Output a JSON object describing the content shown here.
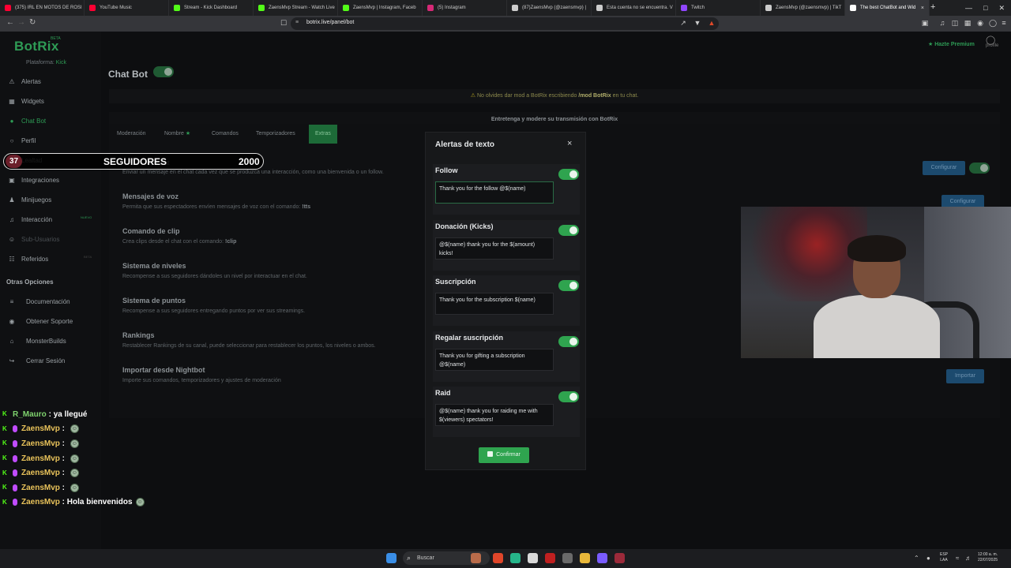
{
  "browser": {
    "tabs": [
      {
        "label": "(375) IRL EN MOTOS DE ROSI",
        "color": "#ff0033"
      },
      {
        "label": "YouTube Music",
        "color": "#ff0033"
      },
      {
        "label": "Stream - Kick Dashboard",
        "color": "#53fc18"
      },
      {
        "label": "ZaensMvp Stream - Watch Live",
        "color": "#53fc18"
      },
      {
        "label": "ZaensMvp | Instagram, Faceb",
        "color": "#53fc18"
      },
      {
        "label": "(5) Instagram",
        "color": "#d62976"
      },
      {
        "label": "(87)ZaensMvp (@zaensmvp) |",
        "color": "#cccccc"
      },
      {
        "label": "Esta cuenta no se encuentra. V",
        "color": "#cccccc"
      },
      {
        "label": "Twitch",
        "color": "#9146ff"
      },
      {
        "label": "ZaensMvp (@zaensmvp) | TikT",
        "color": "#cccccc"
      },
      {
        "label": "The best ChatBot and Wid",
        "color": "#ffffff",
        "active": true
      }
    ],
    "url": "botrix.live/panel/bot"
  },
  "sidebar": {
    "logo": "BotRix",
    "beta": "BETA",
    "platform_label": "Plataforma:",
    "platform_value": "Kick",
    "items": [
      {
        "label": "Alertas",
        "icon": "alert-icon"
      },
      {
        "label": "Widgets",
        "icon": "widgets-icon"
      },
      {
        "label": "Chat Bot",
        "icon": "chatbot-icon"
      },
      {
        "label": "Perfil",
        "icon": "profile-icon"
      },
      {
        "label": "Lealtad",
        "icon": "loyalty-icon"
      },
      {
        "label": "Integraciones",
        "icon": "integrations-icon"
      },
      {
        "label": "Minijuegos",
        "icon": "minigames-icon"
      },
      {
        "label": "Interacción",
        "icon": "interaction-icon"
      },
      {
        "label": "Sub-Usuarios",
        "icon": "subusers-icon"
      },
      {
        "label": "Referidos",
        "icon": "referrals-icon"
      }
    ],
    "badge_nuevo": "NUEVO",
    "badge_beta": "BETA",
    "other_options_title": "Otras Opciones",
    "other_items": [
      {
        "label": "Documentación",
        "icon": "docs-icon"
      },
      {
        "label": "Obtener Soporte",
        "icon": "support-icon"
      },
      {
        "label": "MonsterBuilds",
        "icon": "monster-icon"
      },
      {
        "label": "Cerrar Sesión",
        "icon": "logout-icon"
      }
    ]
  },
  "header": {
    "premium": "Hazte Premium",
    "profile": "profile"
  },
  "main": {
    "title": "Chat Bot",
    "notice_pre": "No olvides dar mod a BotRix escribiendo",
    "notice_cmd": "/mod BotRix",
    "notice_post": "en tu chat.",
    "panel_heading": "Entretenga y modere su transmisión con BotRix",
    "tabs": [
      "Moderación",
      "Nombre",
      "Comandos",
      "Temporizadores",
      "Extras"
    ],
    "partial_label": "chat",
    "partial_desc": "Enviar un mensaje en el chat cada vez que se produzca una interacción, como una bienvenida o un follow.",
    "features": [
      {
        "title": "Mensajes de voz",
        "desc": "Permita que sus espectadores envíen mensajes de voz con el comando:",
        "cmd": "!tts"
      },
      {
        "title": "Comando de clip",
        "desc": "Crea clips desde el chat con el comando:",
        "cmd": "!clip"
      },
      {
        "title": "Sistema de niveles",
        "desc": "Recompense a sus seguidores dándoles un nivel por interactuar en el chat.",
        "cmd": ""
      },
      {
        "title": "Sistema de puntos",
        "desc": "Recompense a sus seguidores entregando puntos por ver sus streamings.",
        "cmd": ""
      },
      {
        "title": "Rankings",
        "desc": "Restablecer Rankings de su canal, puede seleccionar para restablecer los puntos, los niveles o ambos.",
        "cmd": ""
      },
      {
        "title": "Importar desde Nightbot",
        "desc": "Importe sus comandos, temporizadores y ajustes de moderación",
        "cmd": ""
      }
    ],
    "configure_label": "Configurar",
    "import_label": "Importar"
  },
  "modal": {
    "title": "Alertas de texto",
    "close": "×",
    "sections": [
      {
        "label": "Follow",
        "text": "Thank you for the follow @$(name)",
        "enabled": true
      },
      {
        "label": "Donación (Kicks)",
        "text": "@$(name) thank you for the $(amount) kicks!",
        "enabled": true
      },
      {
        "label": "Suscripción",
        "text": "Thank you for the subscription $(name)",
        "enabled": true
      },
      {
        "label": "Regalar suscripción",
        "text": "Thank you for gifting a subscription @$(name)",
        "enabled": true
      },
      {
        "label": "Raid",
        "text": "@$(name) thank you for raiding me with $(viewers) spectators!",
        "enabled": true
      }
    ],
    "confirm": "Confirmar"
  },
  "overlay": {
    "followers_count": "37",
    "followers_label": "SEGUIDORES",
    "followers_goal": "2000",
    "chat": [
      {
        "user": "R_Mauro",
        "msg": "ya llegué",
        "emote": false,
        "mic": false
      },
      {
        "user": "ZaensMvp",
        "msg": "",
        "emote": true,
        "mic": true
      },
      {
        "user": "ZaensMvp",
        "msg": "",
        "emote": true,
        "mic": true
      },
      {
        "user": "ZaensMvp",
        "msg": "",
        "emote": true,
        "mic": true
      },
      {
        "user": "ZaensMvp",
        "msg": "",
        "emote": true,
        "mic": true
      },
      {
        "user": "ZaensMvp",
        "msg": "",
        "emote": true,
        "mic": true
      },
      {
        "user": "ZaensMvp",
        "msg": "Hola bienvenidos",
        "emote": true,
        "mic": true
      }
    ]
  },
  "taskbar": {
    "search": "Buscar",
    "lang_1": "ESP",
    "lang_2": "LAA",
    "time": "12:00 a. m.",
    "date": "22/07/2025"
  }
}
